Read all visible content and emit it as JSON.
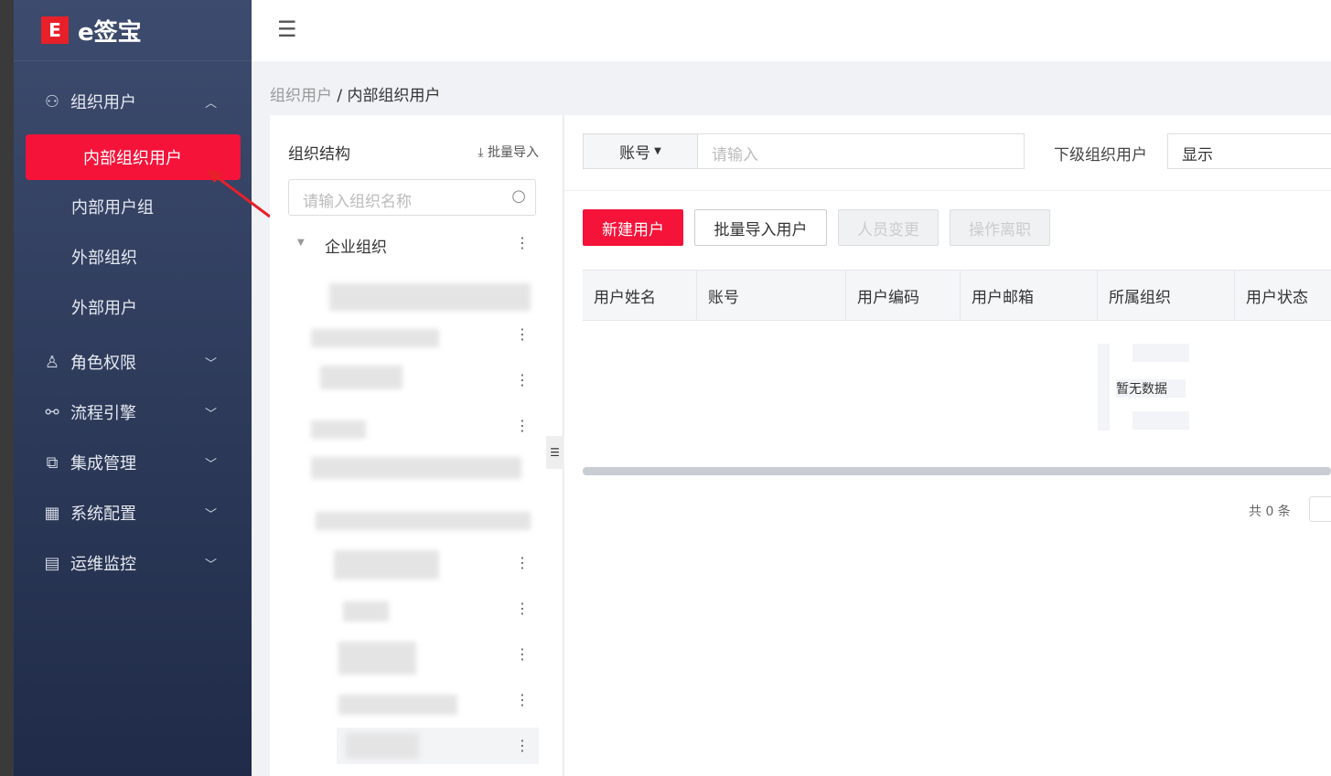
{
  "app": {
    "logo_mark": "E",
    "logo_text": "e签宝"
  },
  "sidebar": {
    "items": [
      {
        "label": "组织用户",
        "icon": "users-icon",
        "expanded": true
      },
      {
        "label": "内部组织用户",
        "active": true
      },
      {
        "label": "内部用户组"
      },
      {
        "label": "外部组织"
      },
      {
        "label": "外部用户"
      },
      {
        "label": "角色权限",
        "icon": "user-icon"
      },
      {
        "label": "流程引擎",
        "icon": "flow-icon"
      },
      {
        "label": "集成管理",
        "icon": "integration-icon"
      },
      {
        "label": "系统配置",
        "icon": "grid-icon"
      },
      {
        "label": "运维监控",
        "icon": "monitor-icon"
      }
    ]
  },
  "breadcrumb": {
    "parent": "组织用户",
    "sep": " / ",
    "current": "内部组织用户"
  },
  "tree": {
    "title": "组织结构",
    "import": "批量导入",
    "search_placeholder": "请输入组织名称",
    "root": "企业组织"
  },
  "filter": {
    "field": "账号",
    "placeholder": "请输入",
    "sub_label": "下级组织用户",
    "sub_value": "显示"
  },
  "toolbar": {
    "new": "新建用户",
    "import": "批量导入用户",
    "change": "人员变更",
    "leave": "操作离职"
  },
  "table": {
    "columns": [
      "用户姓名",
      "账号",
      "用户编码",
      "用户邮箱",
      "所属组织",
      "用户状态"
    ],
    "empty": "暂无数据"
  },
  "pagination": {
    "total": "共 0 条"
  },
  "colors": {
    "accent": "#f5133a"
  }
}
